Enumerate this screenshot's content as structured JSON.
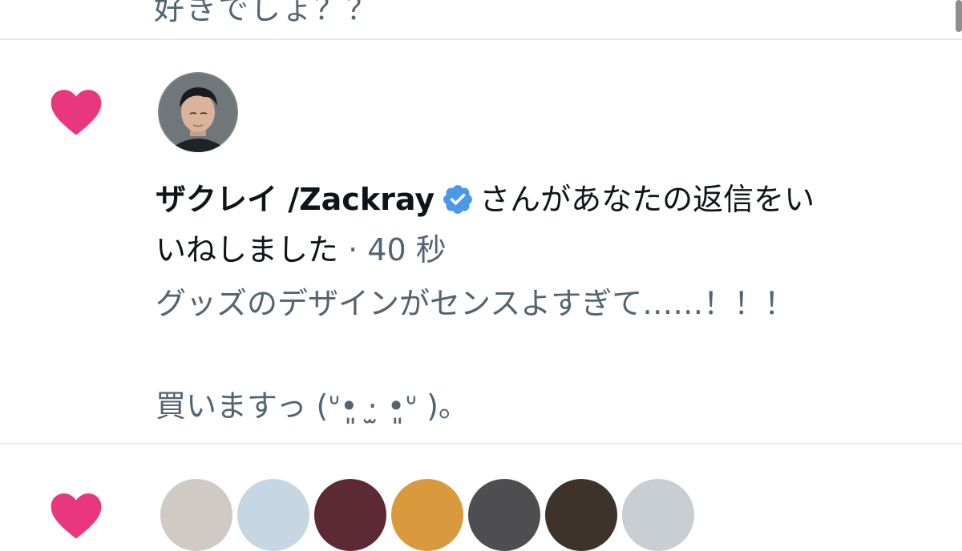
{
  "previous_item": {
    "text_tail": "好きでしょ？？"
  },
  "notification": {
    "icon": "heart-icon",
    "accent_color": "#e8377f",
    "actor_name": "ザクレイ /Zackray",
    "verified_badge": "verified-badge-icon",
    "verified_color": "#4a99e9",
    "action_line1": "さんがあなたの返信をい",
    "action_line2": "いねしました",
    "time_separator": " · ",
    "time": "40 秒",
    "reply_line1": "グッズのデザインがセンスよすぎて……！！！",
    "reply_line2": "買いますっ (ᐡ•͈ ·̫ •͈ᐡ )。"
  },
  "next_item": {
    "icon": "heart-icon",
    "avatars": [
      "avatar-1",
      "avatar-2",
      "avatar-3",
      "avatar-4",
      "avatar-5",
      "avatar-6",
      "avatar-7"
    ]
  }
}
